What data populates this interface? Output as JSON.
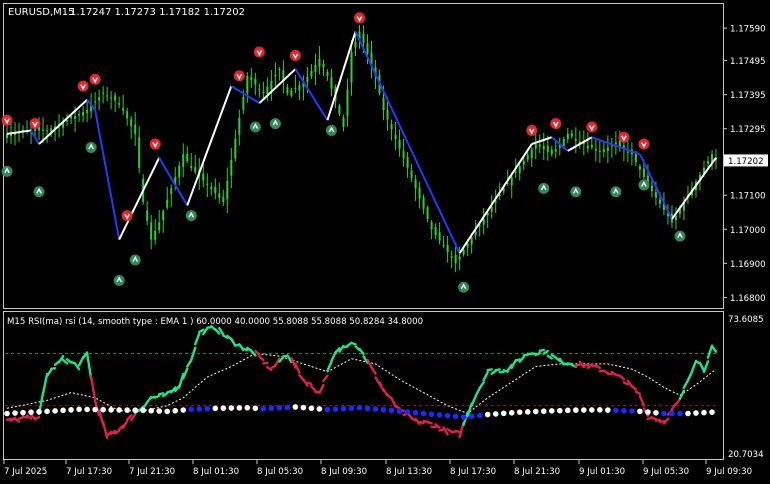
{
  "window": {
    "symbol_label": "EURUSD,M15",
    "ohlc_label": "1.17247 1.17273 1.17182 1.17202"
  },
  "indicator": {
    "label": "M15 RSI(ma) rsi (14, smooth type : EMA  1 ) 60.0000 40.0000 55.8088 55.8088 50.8284 34.8000"
  },
  "colors": {
    "background": "#000000",
    "frame": "#c8c8c8",
    "candle": "#32cd32",
    "zigzag_up": "#ffffff",
    "zigzag_down": "#1e3cff",
    "arrow_up": "#2e8b57",
    "arrow_down": "#e0282e",
    "rsi_up": "#19e887",
    "rsi_down": "#e0204a",
    "rsi_signal": "#ffffff",
    "level_upper": "#1f8a1f",
    "level_lower": "#a01010",
    "dots_bull": "#ffffff",
    "dots_bear": "#1e28ff",
    "price_box": "#ffffff",
    "text": "#ffffff"
  },
  "chart_data": [
    {
      "type": "candlestick",
      "title": "EURUSD,M15",
      "y_ticks": [
        "1.17590",
        "1.17495",
        "1.17395",
        "1.17295",
        "1.17100",
        "1.17000",
        "1.16900",
        "1.16800"
      ],
      "y_tick_values": [
        1.1759,
        1.17495,
        1.17395,
        1.17295,
        1.171,
        1.17,
        1.169,
        1.168
      ],
      "ylim": [
        1.16775,
        1.17655
      ],
      "current_price_label": "1.17202",
      "current_price": 1.17202,
      "x_ticks": [
        "7 Jul 2025",
        "7 Jul 17:30",
        "7 Jul 21:30",
        "8 Jul 01:30",
        "8 Jul 05:30",
        "8 Jul 09:30",
        "8 Jul 13:30",
        "8 Jul 17:30",
        "8 Jul 21:30",
        "9 Jul 01:30",
        "9 Jul 05:30",
        "9 Jul 09:30"
      ],
      "bar_count": 178,
      "close_path": [
        [
          0,
          1.1728
        ],
        [
          8,
          1.1729
        ],
        [
          10,
          1.1729
        ],
        [
          20,
          1.1735
        ],
        [
          24,
          1.174
        ],
        [
          28,
          1.1737
        ],
        [
          32,
          1.1728
        ],
        [
          34,
          1.1708
        ],
        [
          36,
          1.1697
        ],
        [
          38,
          1.1702
        ],
        [
          44,
          1.1722
        ],
        [
          46,
          1.1718
        ],
        [
          54,
          1.1708
        ],
        [
          60,
          1.1745
        ],
        [
          64,
          1.174
        ],
        [
          68,
          1.1747
        ],
        [
          70,
          1.174
        ],
        [
          74,
          1.1743
        ],
        [
          78,
          1.175
        ],
        [
          80,
          1.1745
        ],
        [
          84,
          1.173
        ],
        [
          86,
          1.1752
        ],
        [
          88,
          1.1758
        ],
        [
          92,
          1.1745
        ],
        [
          94,
          1.1735
        ],
        [
          100,
          1.1718
        ],
        [
          106,
          1.17
        ],
        [
          112,
          1.169
        ],
        [
          114,
          1.1694
        ],
        [
          124,
          1.1712
        ],
        [
          132,
          1.1725
        ],
        [
          136,
          1.1722
        ],
        [
          140,
          1.1728
        ],
        [
          144,
          1.1725
        ],
        [
          148,
          1.1723
        ],
        [
          152,
          1.1725
        ],
        [
          156,
          1.1722
        ],
        [
          160,
          1.1713
        ],
        [
          166,
          1.1702
        ],
        [
          170,
          1.171
        ],
        [
          176,
          1.1722
        ],
        [
          177,
          1.17202
        ]
      ],
      "zigzag": [
        {
          "bar": 0,
          "price": 1.1728
        },
        {
          "bar": 6,
          "price": 1.1729
        },
        {
          "bar": 8,
          "price": 1.1725
        },
        {
          "bar": 20,
          "price": 1.1738
        },
        {
          "bar": 22,
          "price": 1.1735
        },
        {
          "bar": 28,
          "price": 1.1697
        },
        {
          "bar": 38,
          "price": 1.1721
        },
        {
          "bar": 45,
          "price": 1.1707
        },
        {
          "bar": 56,
          "price": 1.1742
        },
        {
          "bar": 63,
          "price": 1.1737
        },
        {
          "bar": 72,
          "price": 1.1747
        },
        {
          "bar": 80,
          "price": 1.1732
        },
        {
          "bar": 87,
          "price": 1.1758
        },
        {
          "bar": 113,
          "price": 1.1693
        },
        {
          "bar": 131,
          "price": 1.1725
        },
        {
          "bar": 136,
          "price": 1.1727
        },
        {
          "bar": 140,
          "price": 1.1723
        },
        {
          "bar": 146,
          "price": 1.1727
        },
        {
          "bar": 158,
          "price": 1.1722
        },
        {
          "bar": 166,
          "price": 1.1703
        },
        {
          "bar": 177,
          "price": 1.1721
        }
      ],
      "down_arrows": [
        {
          "bar": 0,
          "price": 1.1732
        },
        {
          "bar": 7,
          "price": 1.1731
        },
        {
          "bar": 19,
          "price": 1.1742
        },
        {
          "bar": 22,
          "price": 1.1744
        },
        {
          "bar": 30,
          "price": 1.1704
        },
        {
          "bar": 37,
          "price": 1.1725
        },
        {
          "bar": 58,
          "price": 1.1745
        },
        {
          "bar": 63,
          "price": 1.1752
        },
        {
          "bar": 72,
          "price": 1.1751
        },
        {
          "bar": 88,
          "price": 1.1762
        },
        {
          "bar": 131,
          "price": 1.1729
        },
        {
          "bar": 137,
          "price": 1.1731
        },
        {
          "bar": 146,
          "price": 1.173
        },
        {
          "bar": 154,
          "price": 1.1727
        },
        {
          "bar": 159,
          "price": 1.1725
        }
      ],
      "up_arrows": [
        {
          "bar": 0,
          "price": 1.1717
        },
        {
          "bar": 8,
          "price": 1.1711
        },
        {
          "bar": 21,
          "price": 1.1724
        },
        {
          "bar": 28,
          "price": 1.1685
        },
        {
          "bar": 32,
          "price": 1.1691
        },
        {
          "bar": 46,
          "price": 1.1704
        },
        {
          "bar": 62,
          "price": 1.173
        },
        {
          "bar": 67,
          "price": 1.1731
        },
        {
          "bar": 81,
          "price": 1.1729
        },
        {
          "bar": 114,
          "price": 1.1683
        },
        {
          "bar": 134,
          "price": 1.1712
        },
        {
          "bar": 142,
          "price": 1.1711
        },
        {
          "bar": 152,
          "price": 1.1711
        },
        {
          "bar": 159,
          "price": 1.1713
        },
        {
          "bar": 168,
          "price": 1.1698
        }
      ]
    },
    {
      "type": "line",
      "title": "M15 RSI(ma) rsi (14, smooth type : EMA  1 ) 60.0000 40.0000 55.8088 55.8088 50.8284 34.8000",
      "y_ticks": [
        "73.6085",
        "20.7034"
      ],
      "ylim": [
        20.7034,
        73.6085
      ],
      "levels": [
        60,
        40
      ],
      "rsi": [
        [
          0,
          34
        ],
        [
          4,
          35
        ],
        [
          8,
          36
        ],
        [
          10,
          52
        ],
        [
          14,
          58
        ],
        [
          18,
          55
        ],
        [
          20,
          60
        ],
        [
          22,
          42
        ],
        [
          25,
          28
        ],
        [
          28,
          31
        ],
        [
          32,
          37
        ],
        [
          36,
          43
        ],
        [
          40,
          44
        ],
        [
          43,
          48
        ],
        [
          46,
          58
        ],
        [
          48,
          68
        ],
        [
          52,
          70
        ],
        [
          55,
          66
        ],
        [
          58,
          63
        ],
        [
          62,
          60
        ],
        [
          66,
          54
        ],
        [
          70,
          60
        ],
        [
          74,
          50
        ],
        [
          78,
          45
        ],
        [
          82,
          60
        ],
        [
          86,
          65
        ],
        [
          88,
          62
        ],
        [
          90,
          57
        ],
        [
          94,
          46
        ],
        [
          98,
          38
        ],
        [
          102,
          34
        ],
        [
          106,
          33
        ],
        [
          110,
          30
        ],
        [
          113,
          29
        ],
        [
          116,
          41
        ],
        [
          120,
          53
        ],
        [
          125,
          54
        ],
        [
          130,
          60
        ],
        [
          134,
          61
        ],
        [
          138,
          57
        ],
        [
          142,
          56
        ],
        [
          146,
          55
        ],
        [
          150,
          53
        ],
        [
          154,
          50
        ],
        [
          158,
          44
        ],
        [
          160,
          36
        ],
        [
          164,
          34
        ],
        [
          168,
          42
        ],
        [
          172,
          58
        ],
        [
          174,
          54
        ],
        [
          176,
          62
        ],
        [
          177,
          60
        ]
      ],
      "rsi_signal": [
        [
          0,
          39
        ],
        [
          10,
          42
        ],
        [
          16,
          45
        ],
        [
          22,
          43
        ],
        [
          28,
          38
        ],
        [
          34,
          38
        ],
        [
          40,
          40
        ],
        [
          44,
          43
        ],
        [
          50,
          51
        ],
        [
          56,
          55
        ],
        [
          62,
          60
        ],
        [
          68,
          59
        ],
        [
          74,
          56
        ],
        [
          80,
          53
        ],
        [
          86,
          58
        ],
        [
          92,
          56
        ],
        [
          98,
          50
        ],
        [
          104,
          45
        ],
        [
          110,
          40
        ],
        [
          115,
          37
        ],
        [
          120,
          43
        ],
        [
          126,
          49
        ],
        [
          132,
          55
        ],
        [
          138,
          56
        ],
        [
          144,
          56
        ],
        [
          150,
          56
        ],
        [
          156,
          54
        ],
        [
          160,
          51
        ],
        [
          164,
          47
        ],
        [
          168,
          44
        ],
        [
          172,
          48
        ],
        [
          177,
          54
        ]
      ],
      "dots": [
        [
          0,
          37,
          "bull"
        ],
        [
          12,
          38,
          "bull"
        ],
        [
          18,
          38.6,
          "bull"
        ],
        [
          26,
          38.4,
          "bull"
        ],
        [
          34,
          38.2,
          "bull"
        ],
        [
          40,
          37.8,
          "bull"
        ],
        [
          46,
          38.6,
          "bear"
        ],
        [
          52,
          39.0,
          "bull"
        ],
        [
          60,
          39.2,
          "bull"
        ],
        [
          64,
          38.8,
          "bear"
        ],
        [
          72,
          39.5,
          "bull"
        ],
        [
          80,
          38.5,
          "bear"
        ],
        [
          88,
          39.2,
          "bear"
        ],
        [
          96,
          38.2,
          "bear"
        ],
        [
          104,
          37.0,
          "bear"
        ],
        [
          114,
          35.6,
          "bear"
        ],
        [
          120,
          36.6,
          "bull"
        ],
        [
          128,
          37.5,
          "bull"
        ],
        [
          136,
          38.0,
          "bull"
        ],
        [
          142,
          38.3,
          "bull"
        ],
        [
          148,
          38.4,
          "bull"
        ],
        [
          152,
          38.2,
          "bear"
        ],
        [
          158,
          37.8,
          "bull"
        ],
        [
          164,
          37.0,
          "bear"
        ],
        [
          170,
          37.0,
          "bull"
        ],
        [
          177,
          37.6,
          "bull"
        ]
      ]
    }
  ]
}
